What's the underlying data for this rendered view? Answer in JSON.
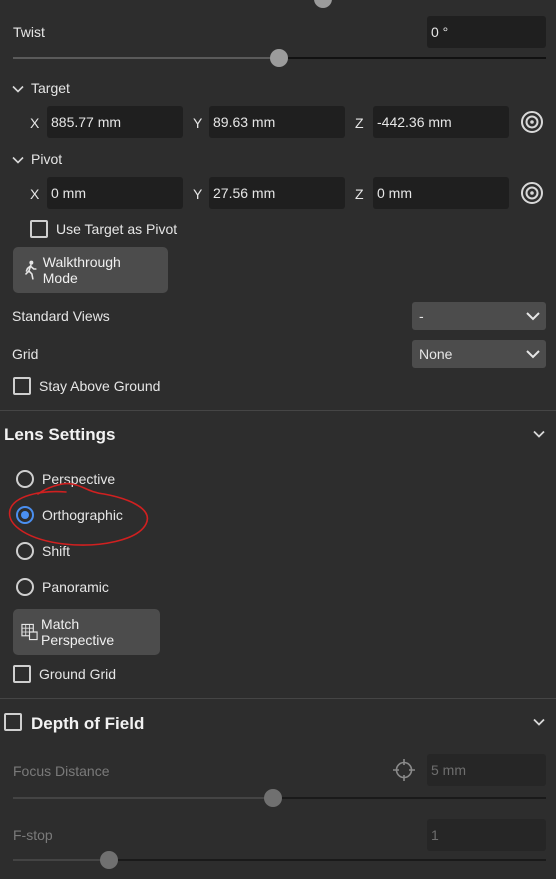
{
  "twist": {
    "label": "Twist",
    "value": "0 °",
    "slider_fraction": 0.5
  },
  "target": {
    "label": "Target",
    "x_label": "X",
    "x": "885.77 mm",
    "y_label": "Y",
    "y": "89.63 mm",
    "z_label": "Z",
    "z": "-442.36 mm"
  },
  "pivot": {
    "label": "Pivot",
    "x_label": "X",
    "x": "0 mm",
    "y_label": "Y",
    "y": "27.56 mm",
    "z_label": "Z",
    "z": "0 mm"
  },
  "use_target_as_pivot": {
    "label": "Use Target as Pivot",
    "checked": false
  },
  "walkthrough_button": "Walkthrough Mode",
  "standard_views": {
    "label": "Standard Views",
    "value": "-"
  },
  "grid": {
    "label": "Grid",
    "value": "None"
  },
  "stay_above_ground": {
    "label": "Stay Above Ground",
    "checked": false
  },
  "lens_settings": {
    "title": "Lens Settings",
    "options": [
      {
        "label": "Perspective",
        "selected": false
      },
      {
        "label": "Orthographic",
        "selected": true
      },
      {
        "label": "Shift",
        "selected": false
      },
      {
        "label": "Panoramic",
        "selected": false
      }
    ],
    "match_perspective_button": "Match Perspective",
    "ground_grid": {
      "label": "Ground Grid",
      "checked": false
    }
  },
  "depth_of_field": {
    "title": "Depth of Field",
    "enabled": false,
    "focus_distance": {
      "label": "Focus Distance",
      "value": "5 mm",
      "slider_fraction": 0.48
    },
    "fstop": {
      "label": "F-stop",
      "value": "1",
      "slider_fraction": 0.16
    }
  },
  "colors": {
    "accent": "#4a8ff0",
    "annotation": "#d02020"
  }
}
